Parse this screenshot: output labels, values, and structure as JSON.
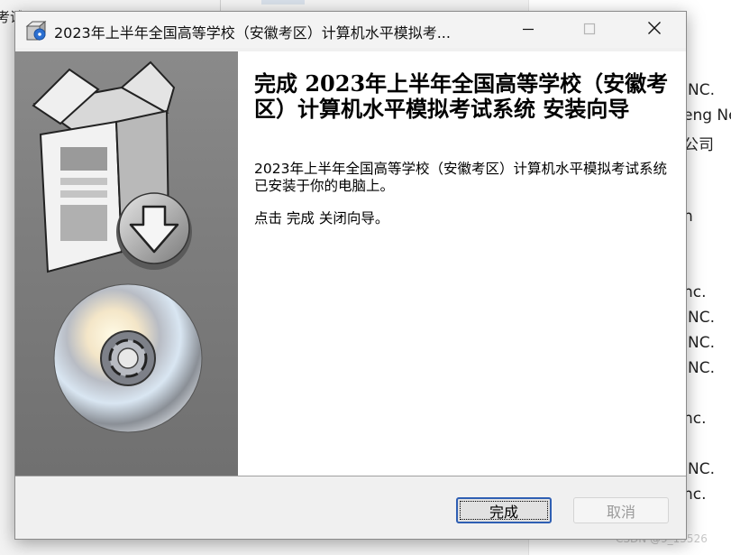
{
  "background": {
    "left_text": "考试",
    "right_items": [
      "INC.",
      "eng Ne",
      "公司",
      "n",
      "nc.",
      "INC.",
      "INC.",
      "INC.",
      "nc.",
      "INC.",
      "nc."
    ],
    "watermark": "CSDN @9_15526"
  },
  "dialog": {
    "title": "2023年上半年全国高等学校（安徽考区）计算机水平模拟考...",
    "heading": "完成 2023年上半年全国高等学校（安徽考区）计算机水平模拟考试系统 安装向导",
    "message": "2023年上半年全国高等学校（安徽考区）计算机水平模拟考试系统 已安装于你的电脑上。",
    "hint": "点击 完成 关闭向导。",
    "finish_label": "完成",
    "cancel_label": "取消"
  },
  "icons": {
    "app": "setup-app-icon",
    "minimize": "minimize-icon",
    "maximize": "maximize-icon",
    "close": "close-icon",
    "box": "software-box-icon",
    "download": "download-arrow-icon",
    "disc": "cd-disc-icon"
  },
  "colors": {
    "sidebar": "#7d7d7d",
    "focus_border": "#2f5fb3",
    "disabled_text": "#9a9a9a"
  }
}
